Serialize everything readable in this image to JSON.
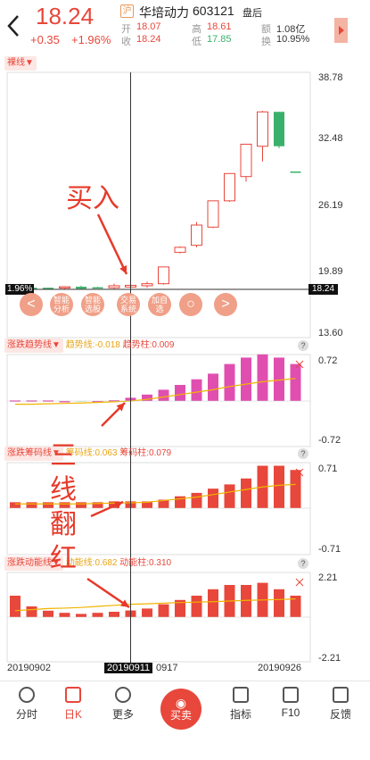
{
  "header": {
    "back_icon": "chevron-left-icon",
    "price": "18.24",
    "change": "+0.35",
    "change_pct": "+1.96%",
    "market_tag": "沪",
    "stock_name": "华培动力",
    "stock_code": "603121",
    "status": "盘后",
    "quotes": {
      "open_label": "开",
      "open": "18.07",
      "close_label": "收",
      "close": "18.24",
      "high_label": "高",
      "high": "18.61",
      "low_label": "低",
      "low": "17.85",
      "amount_label": "额",
      "amount": "1.08亿",
      "turnover_label": "换",
      "turnover": "10.95%"
    },
    "colors": {
      "up": "#e8473b",
      "down": "#3ab16b"
    }
  },
  "chart": {
    "period_select": "裸线▼",
    "price_axis": [
      "38.78",
      "32.48",
      "26.19",
      "19.89",
      "13.60"
    ],
    "crosshair_pct": "1.96%",
    "crosshair_price": "18.24",
    "toolbar": {
      "btn1": "智能分析",
      "btn2": "智能选股",
      "btn3": "交易系统",
      "btn4": "加自选",
      "left_arrow": "<",
      "right_arrow": ">"
    },
    "dates": {
      "start": "20190902",
      "cross": "20190911",
      "mid": "0917",
      "end": "20190926"
    },
    "indicators": [
      {
        "select": "涨跌趋势线▼",
        "line_label": "趋势线:-0.018",
        "bar_label": "趋势柱:0.009",
        "axis_top": "0.72",
        "axis_bottom": "-0.72"
      },
      {
        "select": "涨跌筹码线▼",
        "line_label": "筹码线:0.063",
        "bar_label": "筹码柱:0.079",
        "axis_top": "0.71",
        "axis_bottom": "-0.71"
      },
      {
        "select": "涨跌动能线▼",
        "line_label": "动能线:0.682",
        "bar_label": "动能柱:0.310",
        "axis_top": "2.21",
        "axis_bottom": "-2.21"
      }
    ],
    "help_icon": "?"
  },
  "annotations": {
    "buy": "买入",
    "three_lines": [
      "三",
      "线",
      "翻",
      "红"
    ]
  },
  "bottom_nav": [
    {
      "label": "分时",
      "icon": "clock-icon"
    },
    {
      "label": "日K",
      "icon": "kline-icon"
    },
    {
      "label": "更多",
      "icon": "more-icon"
    },
    {
      "label": "买卖",
      "icon": "trade-icon"
    },
    {
      "label": "指标",
      "icon": "indicator-icon"
    },
    {
      "label": "F10",
      "icon": "f10-icon"
    },
    {
      "label": "反馈",
      "icon": "feedback-icon"
    }
  ],
  "chart_data": {
    "type": "candlestick",
    "ylim": [
      13.6,
      38.78
    ],
    "candles": [
      {
        "o": 17.9,
        "c": 18.0,
        "h": 18.1,
        "l": 17.8,
        "up": false
      },
      {
        "o": 17.95,
        "c": 18.0,
        "h": 18.05,
        "l": 17.9,
        "up": false
      },
      {
        "o": 18.0,
        "c": 17.95,
        "h": 18.0,
        "l": 17.9,
        "up": false
      },
      {
        "o": 18.0,
        "c": 18.1,
        "h": 18.15,
        "l": 17.9,
        "up": true
      },
      {
        "o": 17.9,
        "c": 18.1,
        "h": 18.2,
        "l": 17.8,
        "up": false
      },
      {
        "o": 18.0,
        "c": 18.05,
        "h": 18.1,
        "l": 17.95,
        "up": false
      },
      {
        "o": 18.0,
        "c": 18.2,
        "h": 18.4,
        "l": 17.9,
        "up": true
      },
      {
        "o": 18.07,
        "c": 18.24,
        "h": 18.61,
        "l": 17.85,
        "up": true
      },
      {
        "o": 18.2,
        "c": 18.4,
        "h": 18.6,
        "l": 18.0,
        "up": true
      },
      {
        "o": 18.4,
        "c": 20.06,
        "h": 20.06,
        "l": 18.3,
        "up": true
      },
      {
        "o": 21.5,
        "c": 22.0,
        "h": 22.1,
        "l": 21.4,
        "up": true
      },
      {
        "o": 22.2,
        "c": 24.2,
        "h": 24.5,
        "l": 22.0,
        "up": true
      },
      {
        "o": 24.0,
        "c": 26.6,
        "h": 26.6,
        "l": 23.9,
        "up": true
      },
      {
        "o": 26.6,
        "c": 29.3,
        "h": 29.3,
        "l": 26.5,
        "up": true
      },
      {
        "o": 29.0,
        "c": 32.2,
        "h": 32.2,
        "l": 28.5,
        "up": true
      },
      {
        "o": 32.0,
        "c": 35.4,
        "h": 35.5,
        "l": 30.5,
        "up": true
      },
      {
        "o": 35.4,
        "c": 32.0,
        "h": 35.4,
        "l": 31.8,
        "up": false
      },
      {
        "o": 29.5,
        "c": 29.5,
        "h": 29.5,
        "l": 29.5,
        "up": false
      }
    ],
    "trend_bars": [
      0.008,
      0.008,
      0.008,
      0.0,
      -0.004,
      0.0,
      0.01,
      0.04,
      0.08,
      0.14,
      0.2,
      0.27,
      0.34,
      0.46,
      0.54,
      0.58,
      0.54,
      0.46
    ],
    "trend_line": [
      -0.04,
      -0.04,
      -0.035,
      -0.03,
      -0.025,
      -0.018,
      -0.01,
      0.0,
      0.02,
      0.05,
      0.08,
      0.11,
      0.14,
      0.18,
      0.21,
      0.24,
      0.26,
      0.28
    ],
    "chip_bars": [
      0.07,
      0.07,
      0.07,
      0.07,
      0.07,
      0.07,
      0.08,
      0.08,
      0.08,
      0.1,
      0.14,
      0.18,
      0.23,
      0.28,
      0.35,
      0.5,
      0.5,
      0.45
    ],
    "chip_line": [
      0.05,
      0.05,
      0.05,
      0.05,
      0.05,
      0.055,
      0.06,
      0.063,
      0.07,
      0.09,
      0.11,
      0.13,
      0.16,
      0.19,
      0.22,
      0.25,
      0.27,
      0.28
    ],
    "mom_bars": [
      1.0,
      0.5,
      0.3,
      0.2,
      0.15,
      0.2,
      0.25,
      0.31,
      0.4,
      0.6,
      0.8,
      1.0,
      1.3,
      1.5,
      1.5,
      1.6,
      1.3,
      1.0
    ],
    "mom_line": [
      0.3,
      0.35,
      0.4,
      0.42,
      0.45,
      0.5,
      0.55,
      0.6,
      0.62,
      0.65,
      0.68,
      0.7,
      0.72,
      0.75,
      0.78,
      0.8,
      0.82,
      0.85
    ]
  }
}
